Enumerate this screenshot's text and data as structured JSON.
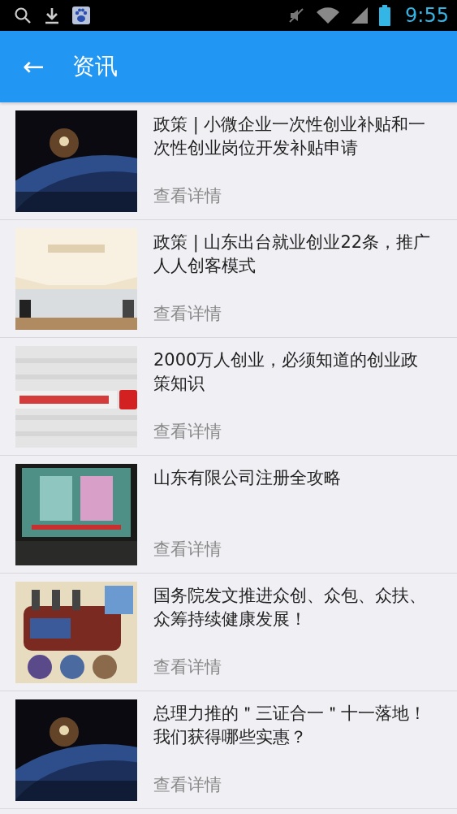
{
  "status_bar": {
    "time": "9:55"
  },
  "app_bar": {
    "back": "←",
    "title": "资讯"
  },
  "articles": [
    {
      "title": "政策 | 小微企业一次性创业补贴和一次性创业岗位开发补贴申请",
      "link": "查看详情"
    },
    {
      "title": "政策 | 山东出台就业创业22条，推广人人创客模式",
      "link": "查看详情"
    },
    {
      "title": "2000万人创业，必须知道的创业政策知识",
      "link": "查看详情"
    },
    {
      "title": "山东有限公司注册全攻略",
      "link": "查看详情"
    },
    {
      "title": "国务院发文推进众创、众包、众扶、众筹持续健康发展！",
      "link": "查看详情"
    },
    {
      "title": "总理力推的＂三证合一＂十一落地！我们获得哪些实惠？",
      "link": "查看详情"
    }
  ]
}
